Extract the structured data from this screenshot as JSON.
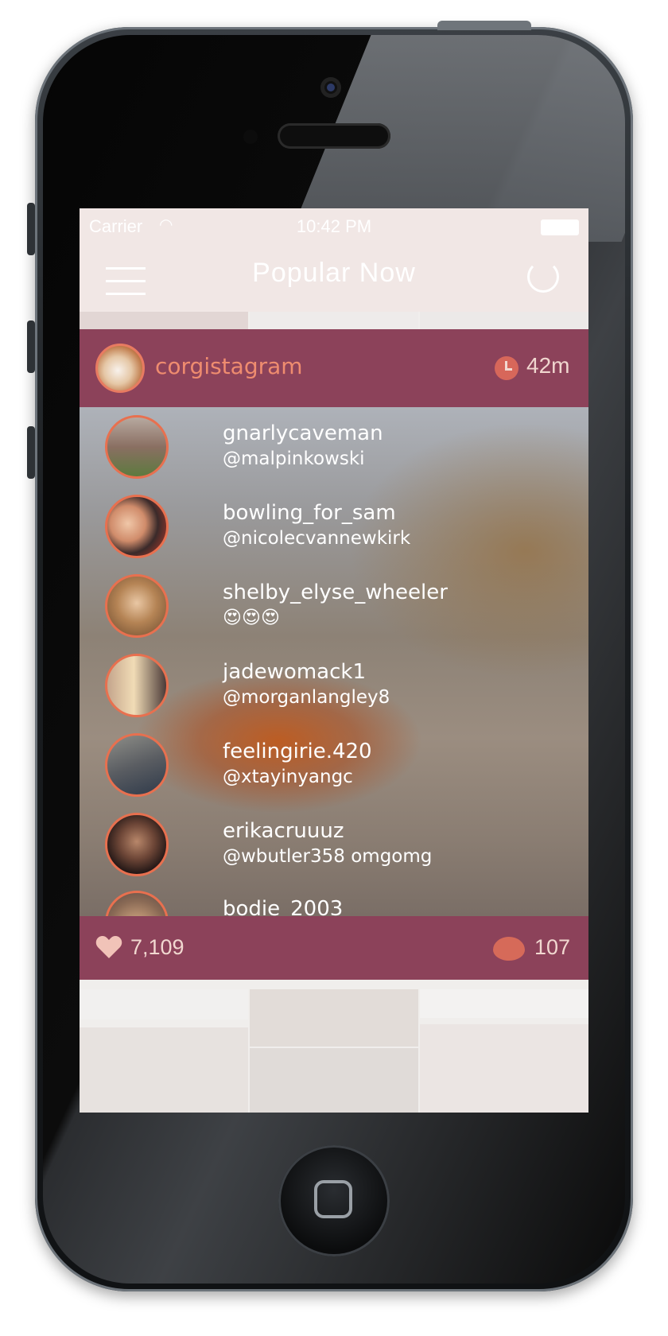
{
  "status_bar": {
    "carrier": "Carrier",
    "time": "10:42 PM"
  },
  "navbar": {
    "title": "Popular Now"
  },
  "post": {
    "username": "corgistagram",
    "age": "42m",
    "likes": "7,109",
    "comments": "107"
  },
  "likers": [
    {
      "name": "gnarlycaveman",
      "sub": "@malpinkowski"
    },
    {
      "name": "bowling_for_sam",
      "sub": "@nicolecvannewkirk"
    },
    {
      "name": "shelby_elyse_wheeler",
      "sub": "😍😍😍"
    },
    {
      "name": "jadewomack1",
      "sub": "@morganlangley8"
    },
    {
      "name": "feelingirie.420",
      "sub": "@xtayinyangc"
    },
    {
      "name": "erikacruuuz",
      "sub": "@wbutler358 omgomg"
    },
    {
      "name": "bodie_2003",
      "sub": ""
    }
  ],
  "colors": {
    "accent": "#8c425a",
    "highlight": "#e8704f",
    "username": "#ef8c6f"
  }
}
